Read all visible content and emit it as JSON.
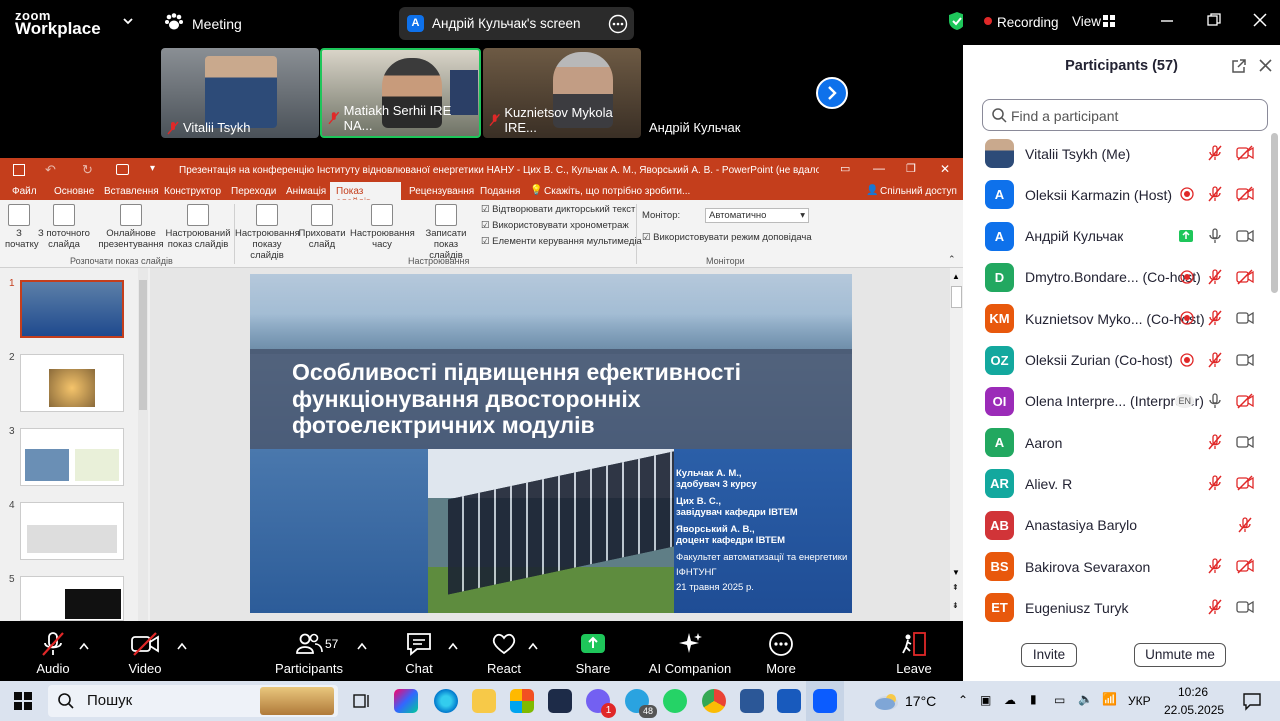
{
  "zoom": {
    "brand_top": "zoom",
    "brand_bottom": "Workplace",
    "meeting_label": "Meeting",
    "share_chip_avatar": "A",
    "share_chip_label": "Андрій Кульчак's screen",
    "recording_label": "Recording",
    "view_label": "View"
  },
  "video_tiles": [
    {
      "name": "Vitalii Tsykh"
    },
    {
      "name": "Matiakh Serhii IRE NA..."
    },
    {
      "name": "Kuznietsov Mykola IRE..."
    },
    {
      "name": "Андрій Кульчак"
    }
  ],
  "powerpoint": {
    "title": "Презентація на конференцію Інституту відновлюваної енергетики НАНУ - Цих В. С., Кульчак А. М., Яворський А. В. - PowerPoint (не вдалося активувати п...",
    "menu": [
      "Файл",
      "Основне",
      "Вставлення",
      "Конструктор",
      "Переходи",
      "Анімація",
      "Показ слайдів",
      "Рецензування",
      "Подання"
    ],
    "active_tab": "Показ слайдів",
    "tell_me": "Скажіть, що потрібно зробити...",
    "share": "Спільний доступ",
    "ribbon": {
      "from_start": "З\nпочатку",
      "from_current": "З поточного\nслайда",
      "online": "Онлайнове\nпрезентування",
      "custom": "Настроюваний\nпоказ слайдів",
      "setup": "Настроювання\nпоказу слайдів",
      "hide": "Приховати\nслайд",
      "rehearse": "Настроювання\nчасу",
      "record": "Записати показ\nслайдів",
      "chk_narration": "Відтворювати дикторський текст",
      "chk_timings": "Використовувати хронометраж",
      "chk_media": "Елементи керування мультимедіа",
      "monitor_label": "Монітор:",
      "monitor_value": "Автоматично",
      "presenter_view": "Використовувати режим доповідача",
      "group_start": "Розпочати показ слайдів",
      "group_setup": "Настроювання",
      "group_monitors": "Монітори"
    },
    "thumb_numbers": [
      "1",
      "2",
      "3",
      "4",
      "5"
    ],
    "slide": {
      "title": "Особливості підвищення ефективності функціонування двосторонніх фотоелектричних модулів",
      "authors": [
        {
          "name": "Кульчак А. М.,",
          "role": "здобувач 3 курсу"
        },
        {
          "name": "Цих В. С.,",
          "role": "завідувач кафедри ІВТЕМ"
        },
        {
          "name": "Яворський А. В.,",
          "role": "доцент кафедри ІВТЕМ"
        }
      ],
      "faculty": "Факультет автоматизації та енергетики",
      "university": "ІФНТУНГ",
      "date": "21 травня 2025 р."
    }
  },
  "participants_panel": {
    "title": "Participants (57)",
    "search_placeholder": "Find a participant",
    "list": [
      {
        "initials": "",
        "name": "Vitalii Tsykh (Me)",
        "color": "#6b7c8f",
        "photo": true
      },
      {
        "initials": "A",
        "name": "Oleksii Karmazin (Host)",
        "color": "#0e71eb"
      },
      {
        "initials": "A",
        "name": "Андрій Кульчак",
        "color": "#0e71eb"
      },
      {
        "initials": "D",
        "name": "Dmytro.Bondare... (Co-host)",
        "color": "#22a860"
      },
      {
        "initials": "KM",
        "name": "Kuznietsov Myko... (Co-host)",
        "color": "#e8580c"
      },
      {
        "initials": "OZ",
        "name": "Oleksii Zurian (Co-host)",
        "color": "#13a89e"
      },
      {
        "initials": "OI",
        "name": "Olena Interpre... (Interpreter)",
        "color": "#9b2bb8",
        "badge": "EN"
      },
      {
        "initials": "A",
        "name": "Aaron",
        "color": "#22a860"
      },
      {
        "initials": "AR",
        "name": "Aliev. R",
        "color": "#13a89e"
      },
      {
        "initials": "AB",
        "name": "Anastasiya Barylo",
        "color": "#d13438"
      },
      {
        "initials": "BS",
        "name": "Bakirova Sevaraxon",
        "color": "#e8580c"
      },
      {
        "initials": "ET",
        "name": "Eugeniusz Turyk",
        "color": "#e8580c"
      }
    ],
    "invite": "Invite",
    "unmute": "Unmute me"
  },
  "toolbar": {
    "audio": "Audio",
    "video": "Video",
    "participants": "Participants",
    "participants_count": "57",
    "chat": "Chat",
    "react": "React",
    "share": "Share",
    "ai": "AI Companion",
    "more": "More",
    "leave": "Leave"
  },
  "taskbar": {
    "search": "Пошук",
    "temperature": "17°C",
    "lang": "УКР",
    "time": "10:26",
    "date": "22.05.2025",
    "viber_badge": "1",
    "telegram_badge": "48"
  },
  "colors": {
    "zoom_blue": "#0e71eb",
    "ppt_red": "#c43e1c",
    "record_red": "#e02828",
    "share_green": "#1ec65a"
  }
}
